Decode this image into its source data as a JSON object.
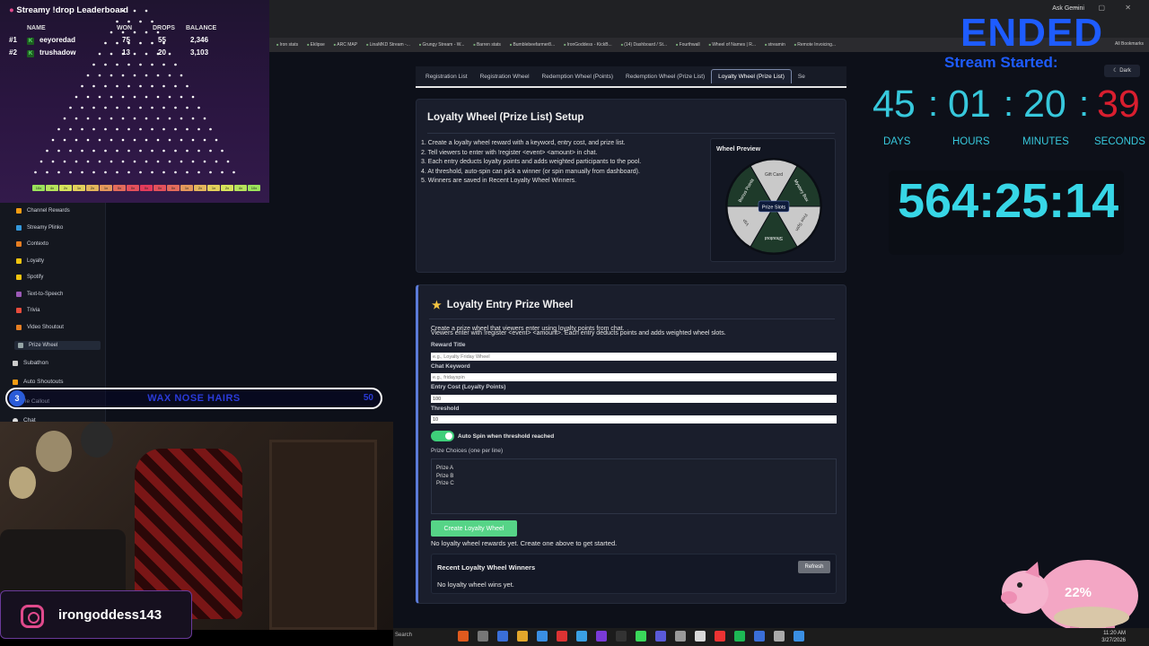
{
  "browser": {
    "ask_gemini": "Ask Gemini",
    "bookmarks": [
      "Iron stats",
      "Eklipse",
      "ARC MAP",
      "LinaMKD Stream -...",
      "Grungy Stream - W...",
      "Barren stats",
      "Bumblebeefarmer8...",
      "IronGoddess - KickB...",
      "(14) Dashboard / St...",
      "Fourthwall",
      "Wheel of Names | R...",
      "streamin",
      "Remote Invoicing..."
    ],
    "all_bookmarks": "All Bookmarks"
  },
  "sidebar": {
    "items": [
      {
        "label": "Channel Rewards",
        "color": "#f39c12"
      },
      {
        "label": "Streamy Plinko",
        "color": "#3498db"
      },
      {
        "label": "Contexto",
        "color": "#e67e22"
      },
      {
        "label": "Loyalty",
        "color": "#f1c40f"
      },
      {
        "label": "Spotify",
        "color": "#f1c40f"
      },
      {
        "label": "Text-to-Speech",
        "color": "#9b59b6"
      },
      {
        "label": "Trivia",
        "color": "#e74c3c"
      },
      {
        "label": "Video Shoutout",
        "color": "#e67e22"
      },
      {
        "label": "Prize Wheel",
        "color": "#95a5a6"
      }
    ],
    "subathon": "Subathon",
    "auto_shoutouts": "Auto Shoutouts",
    "callout": "le Callout",
    "chat": "Chat"
  },
  "tabs": [
    "Registration List",
    "Registration Wheel",
    "Redemption Wheel (Points)",
    "Redemption Wheel (Prize List)",
    "Loyalty Wheel (Prize List)",
    "Se"
  ],
  "setup": {
    "title": "Loyalty Wheel (Prize List) Setup",
    "steps": [
      "1. Create a loyalty wheel reward with a keyword, entry cost, and prize list.",
      "2. Tell viewers to enter with !register <event> <amount> in chat.",
      "3. Each entry deducts loyalty points and adds weighted participants to the pool.",
      "4. At threshold, auto-spin can pick a winner (or spin manually from dashboard).",
      "5. Winners are saved in Recent Loyalty Wheel Winners."
    ],
    "preview_title": "Wheel Preview",
    "center_label": "Prize Slots",
    "slices": [
      "Gift Card",
      "Mystery Box",
      "Free Spin",
      "Shoutout",
      "VIP",
      "Bonus Points"
    ]
  },
  "entry": {
    "title": "Loyalty Entry Prize Wheel",
    "desc1": "Create a prize wheel that viewers enter using loyalty points from chat.",
    "desc2": "Viewers enter with !register <event> <amount>. Each entry deducts points and adds weighted wheel slots.",
    "reward_title_label": "Reward Title",
    "reward_title_placeholder": "e.g., Loyalty Friday Wheel",
    "keyword_label": "Chat Keyword",
    "keyword_placeholder": "e.g., fridayspin",
    "cost_label": "Entry Cost (Loyalty Points)",
    "cost_value": "100",
    "threshold_label": "Threshold",
    "threshold_value": "10",
    "auto_spin_label": "Auto Spin when threshold reached",
    "prizes_label": "Prize Choices (one per line)",
    "prizes": [
      "Prize A",
      "Prize B",
      "Prize C"
    ],
    "create_button": "Create Loyalty Wheel",
    "no_rewards": "No loyalty wheel rewards yet. Create one above to get started.",
    "winners_title": "Recent Loyalty Wheel Winners",
    "refresh_button": "Refresh",
    "winners_none": "No loyalty wheel wins yet."
  },
  "leaderboard": {
    "title": "Streamy !drop Leaderboard",
    "headers": {
      "name": "NAME",
      "won": "WON",
      "drops": "DROPS",
      "balance": "BALANCE"
    },
    "rows": [
      {
        "rank": "#1",
        "name": "eeyoredad",
        "won": "75",
        "drops": "55",
        "balance": "2,346"
      },
      {
        "rank": "#2",
        "name": "trushadow",
        "won": "13",
        "drops": "20",
        "balance": "3,103"
      }
    ],
    "multipliers": [
      "10x",
      "4x",
      "2x",
      "1x",
      "2x",
      "1x",
      "0x",
      "0x",
      "0x",
      "0x",
      "0x",
      "1x",
      "2x",
      "1x",
      "2x",
      "4x",
      "10x"
    ]
  },
  "countdown": {
    "ended": "ENDED",
    "stream_started": "Stream Started:",
    "dark_label": "Dark",
    "days": "45",
    "hours": "01",
    "minutes": "20",
    "seconds": "39",
    "days_label": "DAYS",
    "hours_label": "HOURS",
    "minutes_label": "MINUTES",
    "seconds_label": "SECONDS",
    "elapsed": "564:25:14"
  },
  "overlay": {
    "goal_number": "3",
    "goal_text": "WAX NOSE HAIRS",
    "goal_right": "50",
    "instagram": "irongoddess143",
    "pig_percent": "22%",
    "pig_fill": 0.22
  },
  "taskbar": {
    "search": "Search",
    "time": "11:20 AM",
    "date": "3/27/2026"
  }
}
